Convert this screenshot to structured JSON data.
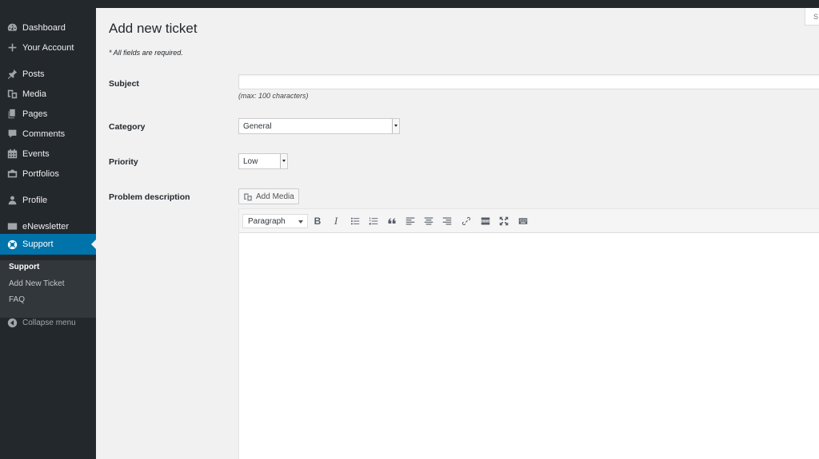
{
  "sidebar": {
    "items": [
      {
        "label": "Dashboard",
        "icon": "dashboard-icon"
      },
      {
        "label": "Your Account",
        "icon": "plus-icon"
      },
      {
        "label": "Posts",
        "icon": "pin-icon"
      },
      {
        "label": "Media",
        "icon": "media-icon"
      },
      {
        "label": "Pages",
        "icon": "pages-icon"
      },
      {
        "label": "Comments",
        "icon": "comment-icon"
      },
      {
        "label": "Events",
        "icon": "calendar-icon"
      },
      {
        "label": "Portfolios",
        "icon": "portfolio-icon"
      },
      {
        "label": "Profile",
        "icon": "user-icon"
      },
      {
        "label": "eNewsletter",
        "icon": "envelope-icon"
      },
      {
        "label": "Support",
        "icon": "lifebuoy-icon",
        "active": true
      }
    ],
    "submenu": [
      "Support",
      "Add New Ticket",
      "FAQ"
    ],
    "collapse_label": "Collapse menu"
  },
  "main": {
    "screen_options_label": "S",
    "title": "Add new ticket",
    "required_note": "* All fields are required.",
    "subject": {
      "label": "Subject",
      "value": "",
      "hint": "(max: 100 characters)"
    },
    "category": {
      "label": "Category",
      "selected": "General"
    },
    "priority": {
      "label": "Priority",
      "selected": "Low"
    },
    "description": {
      "label": "Problem description",
      "add_media_label": "Add Media",
      "format_selected": "Paragraph",
      "content": ""
    }
  },
  "colors": {
    "sidebar_bg": "#23282d",
    "active_bg": "#0073aa",
    "content_bg": "#f1f1f1"
  }
}
